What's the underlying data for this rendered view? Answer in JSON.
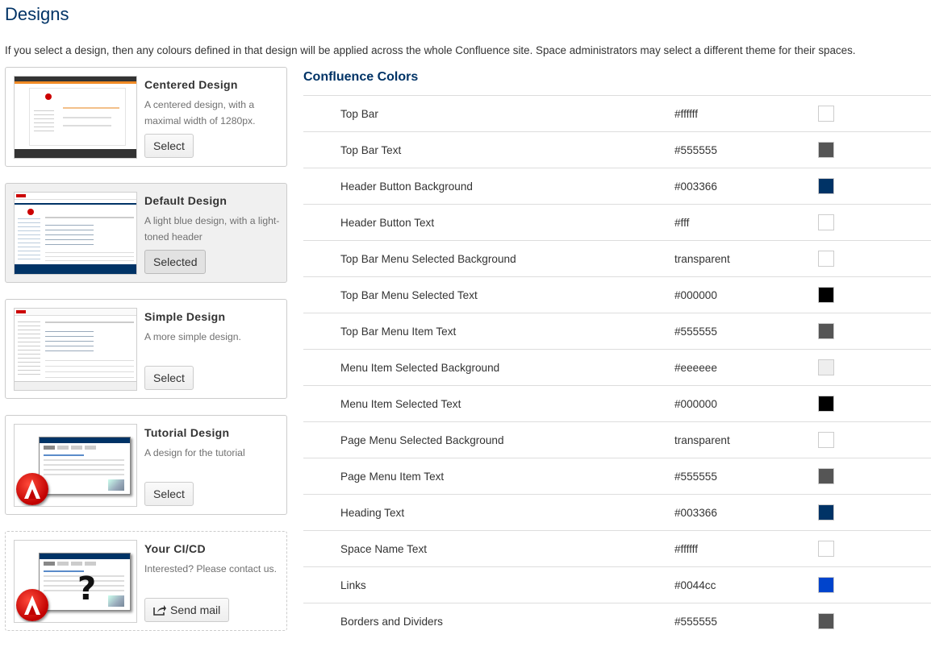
{
  "page": {
    "title": "Designs",
    "intro": "If you select a design, then any colours defined in that design will be applied across the whole Confluence site. Space administrators may select a different theme for their spaces."
  },
  "designs": [
    {
      "title": "Centered Design",
      "description": "A centered design, with a maximal width of 1280px.",
      "button": "Select",
      "selected": false,
      "thumb": "centered"
    },
    {
      "title": "Default Design",
      "description": "A light blue design, with a light-toned header",
      "button": "Selected",
      "selected": true,
      "thumb": "default"
    },
    {
      "title": "Simple Design",
      "description": "A more simple design.",
      "button": "Select",
      "selected": false,
      "thumb": "simple"
    },
    {
      "title": "Tutorial Design",
      "description": "A design for the tutorial",
      "button": "Select",
      "selected": false,
      "thumb": "tutorial"
    },
    {
      "title": "Your CI/CD",
      "description": "Interested? Please contact us.",
      "button": "Send mail",
      "button_icon": "share-icon",
      "selected": false,
      "thumb": "custom"
    }
  ],
  "colors_panel": {
    "title": "Confluence Colors",
    "rows": [
      {
        "name": "Top Bar",
        "value": "#ffffff",
        "swatch": "#ffffff"
      },
      {
        "name": "Top Bar Text",
        "value": "#555555",
        "swatch": "#555555"
      },
      {
        "name": "Header Button Background",
        "value": "#003366",
        "swatch": "#003366"
      },
      {
        "name": "Header Button Text",
        "value": "#fff",
        "swatch": "#ffffff"
      },
      {
        "name": "Top Bar Menu Selected Background",
        "value": "transparent",
        "swatch": "#ffffff"
      },
      {
        "name": "Top Bar Menu Selected Text",
        "value": "#000000",
        "swatch": "#000000"
      },
      {
        "name": "Top Bar Menu Item Text",
        "value": "#555555",
        "swatch": "#555555"
      },
      {
        "name": "Menu Item Selected Background",
        "value": "#eeeeee",
        "swatch": "#eeeeee"
      },
      {
        "name": "Menu Item Selected Text",
        "value": "#000000",
        "swatch": "#000000"
      },
      {
        "name": "Page Menu Selected Background",
        "value": "transparent",
        "swatch": "#ffffff"
      },
      {
        "name": "Page Menu Item Text",
        "value": "#555555",
        "swatch": "#555555"
      },
      {
        "name": "Heading Text",
        "value": "#003366",
        "swatch": "#003366"
      },
      {
        "name": "Space Name Text",
        "value": "#ffffff",
        "swatch": "#ffffff"
      },
      {
        "name": "Links",
        "value": "#0044cc",
        "swatch": "#0044cc"
      },
      {
        "name": "Borders and Dividers",
        "value": "#555555",
        "swatch": "#555555"
      }
    ]
  },
  "theme": {
    "accent": "#003366",
    "logo_red": "#cc0000",
    "centered_orange": "#f08a24"
  }
}
